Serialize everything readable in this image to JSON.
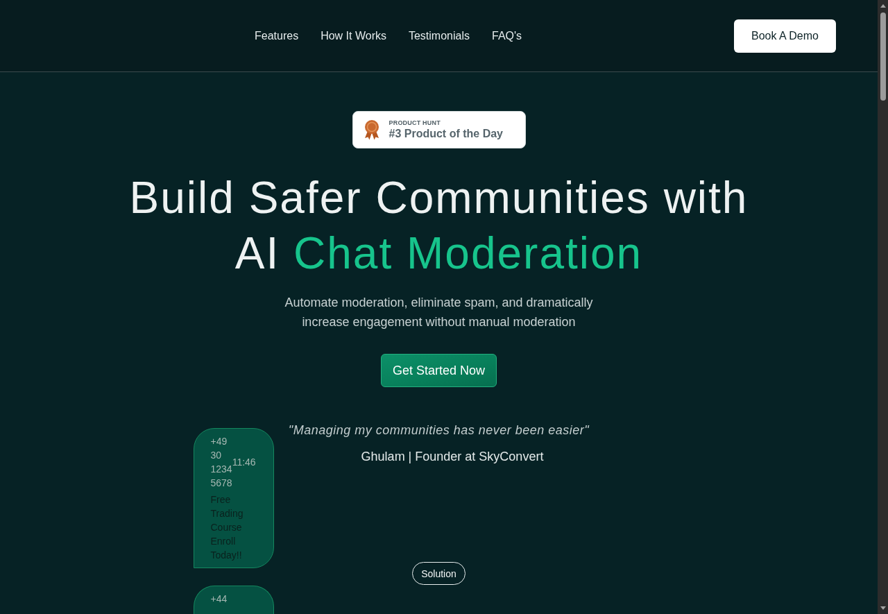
{
  "header": {
    "nav_links": [
      "Features",
      "How It Works",
      "Testimonials",
      "FAQ's"
    ],
    "cta_button": "Book A Demo"
  },
  "hero": {
    "badge": {
      "eyebrow": "PRODUCT HUNT",
      "title": "#3 Product of the Day"
    },
    "headline": {
      "lines": [
        [
          {
            "text": "Build Safer Communities with",
            "accent": false
          }
        ],
        [
          {
            "text": "AI",
            "accent": false
          },
          {
            "text": "Chat Moderation",
            "accent": true
          }
        ]
      ]
    },
    "subtitle": "Automate moderation, eliminate spam, and dramatically increase engagement without manual moderation",
    "cta_button": "Get Started Now"
  },
  "testimonial": {
    "quote": "\"Managing my communities has never been easier\"",
    "author": "Ghulam | Founder at SkyConvert"
  },
  "chat_messages": [
    {
      "phone": "+49 30 1234 5678",
      "time": "11:46",
      "message": "Free Trading Course Enroll Today!!"
    },
    {
      "phone": "+44"
    }
  ],
  "section_tag": "Solution"
}
